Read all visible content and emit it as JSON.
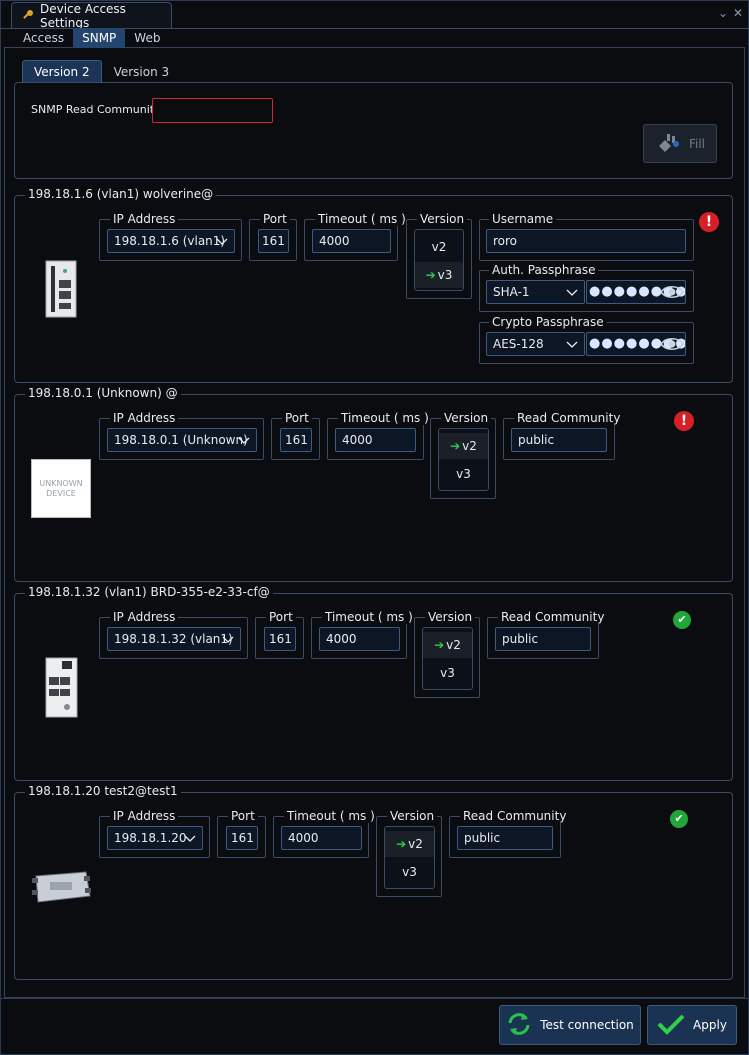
{
  "window": {
    "title": "Device Access Settings",
    "tabs": [
      {
        "label": "Access",
        "active": false
      },
      {
        "label": "SNMP",
        "active": true
      },
      {
        "label": "Web",
        "active": false
      }
    ]
  },
  "snmp": {
    "version_tabs": [
      {
        "label": "Version 2",
        "active": true
      },
      {
        "label": "Version 3",
        "active": false
      }
    ],
    "read_community_label": "SNMP Read Community",
    "read_community_value": "",
    "fill_label": "Fill"
  },
  "labels": {
    "ip": "IP Address",
    "port": "Port",
    "timeout": "Timeout ( ms )",
    "version": "Version",
    "read_community": "Read Community",
    "username": "Username",
    "auth": "Auth. Passphrase",
    "crypto": "Crypto Passphrase",
    "v2": "v2",
    "v3": "v3",
    "unknown_device": "UNKNOWN DEVICE"
  },
  "devices": [
    {
      "title": "198.18.1.6 (vlan1) wolverine@",
      "ip": "198.18.1.6 (vlan1)",
      "port": "161",
      "timeout": "4000",
      "version": "v3",
      "username": "roro",
      "auth_protocol": "SHA-1",
      "auth_pass": "●●●●●●●●●",
      "crypto_protocol": "AES-128",
      "crypto_pass": "●●●●●●●●●",
      "status": "error"
    },
    {
      "title": "198.18.0.1 (Unknown) @",
      "ip": "198.18.0.1 (Unknown)",
      "port": "161",
      "timeout": "4000",
      "version": "v2",
      "read_community": "public",
      "status": "error"
    },
    {
      "title": "198.18.1.32 (vlan1) BRD-355-e2-33-cf@",
      "ip": "198.18.1.32 (vlan1)",
      "port": "161",
      "timeout": "4000",
      "version": "v2",
      "read_community": "public",
      "status": "ok"
    },
    {
      "title": "198.18.1.20 test2@test1",
      "ip": "198.18.1.20",
      "port": "161",
      "timeout": "4000",
      "version": "v2",
      "read_community": "public",
      "status": "ok"
    }
  ],
  "footer": {
    "test_label": "Test connection",
    "apply_label": "Apply"
  },
  "colors": {
    "accent": "#24456e",
    "error": "#d61f26",
    "ok": "#21a63a",
    "arrow": "#2fd04a"
  }
}
